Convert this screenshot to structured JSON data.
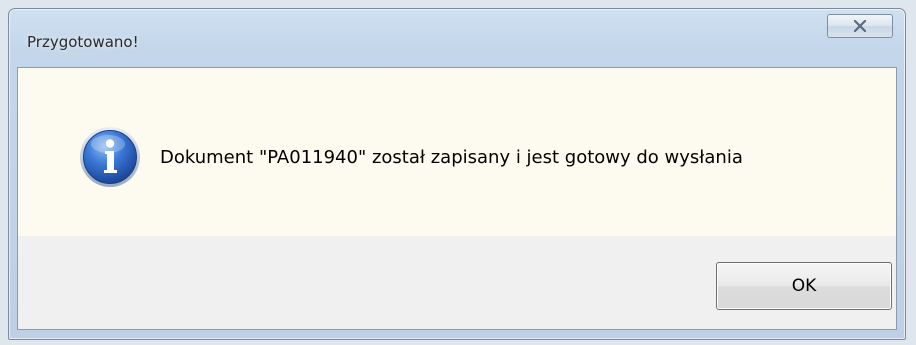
{
  "dialog": {
    "title": "Przygotowano!",
    "message": "Dokument \"PA011940\" został zapisany i jest gotowy do wysłania",
    "icon": "info-icon",
    "ok_label": "OK"
  },
  "titlebar": {
    "close_icon": "close-icon"
  },
  "colors": {
    "message_background": "#fdfbf0",
    "button_area_background": "#f0f0f0",
    "icon_blue": "#2a63c4"
  }
}
